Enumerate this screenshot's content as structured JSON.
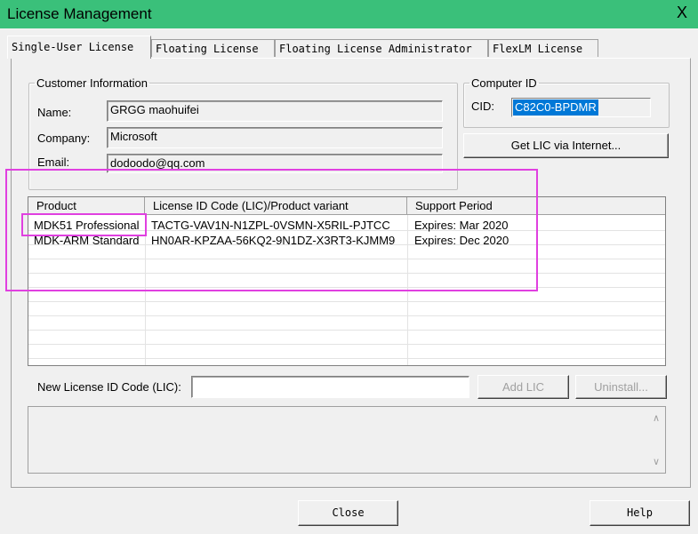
{
  "window": {
    "title": "License Management",
    "close_glyph": "X"
  },
  "tabs": [
    {
      "label": "Single-User License",
      "active": true
    },
    {
      "label": "Floating License",
      "active": false
    },
    {
      "label": "Floating License Administrator",
      "active": false
    },
    {
      "label": "FlexLM License",
      "active": false
    }
  ],
  "customer": {
    "legend": "Customer Information",
    "name_label": "Name:",
    "name_value": "GRGG maohuifei",
    "company_label": "Company:",
    "company_value": "Microsoft",
    "email_label": "Email:",
    "email_value": "dodoodo@qq.com"
  },
  "computer": {
    "legend": "Computer ID",
    "cid_label": "CID:",
    "cid_value": "C82C0-BPDMR",
    "get_lic_label": "Get LIC via Internet..."
  },
  "table": {
    "columns": [
      "Product",
      "License ID Code (LIC)/Product variant",
      "Support Period"
    ],
    "rows": [
      {
        "product": "MDK51 Professional",
        "lic": "TACTG-VAV1N-N1ZPL-0VSMN-X5RIL-PJTCC",
        "period": "Expires: Mar 2020"
      },
      {
        "product": "MDK-ARM Standard",
        "lic": "HN0AR-KPZAA-56KQ2-9N1DZ-X3RT3-KJMM9",
        "period": "Expires: Dec 2020"
      }
    ]
  },
  "new_lic": {
    "label": "New License ID Code (LIC):",
    "value": "",
    "add_label": "Add LIC",
    "uninstall_label": "Uninstall..."
  },
  "footer": {
    "close_label": "Close",
    "help_label": "Help"
  },
  "colors": {
    "titlebar": "#3ac07a",
    "highlight": "#e040e0",
    "selection": "#0078d7"
  }
}
